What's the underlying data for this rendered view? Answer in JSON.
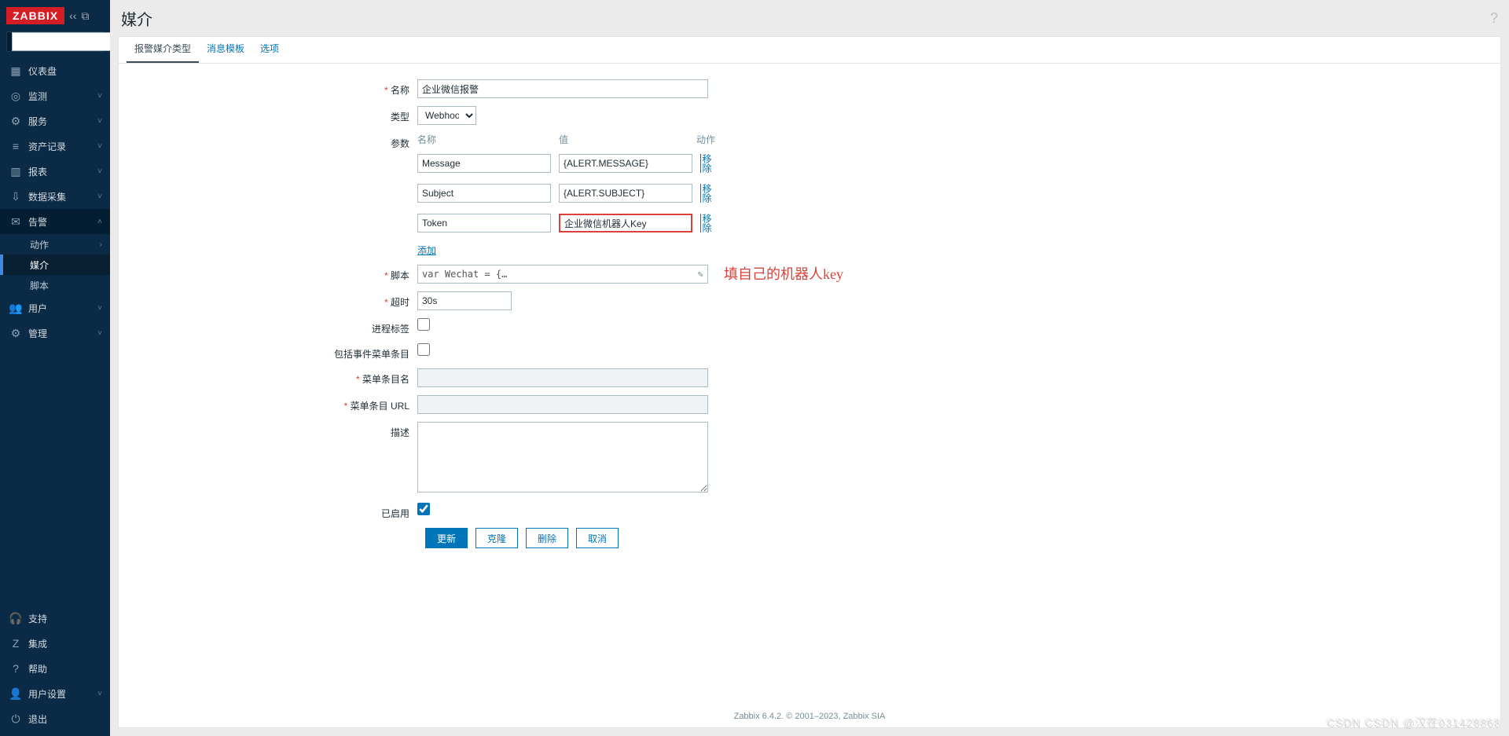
{
  "brand": "ZABBIX",
  "page_title": "媒介",
  "sidebar": {
    "items": [
      {
        "icon": "▦",
        "label": "仪表盘",
        "chev": ""
      },
      {
        "icon": "◎",
        "label": "监测",
        "chev": "˅"
      },
      {
        "icon": "⚙",
        "label": "服务",
        "chev": "˅"
      },
      {
        "icon": "≡",
        "label": "资产记录",
        "chev": "˅"
      },
      {
        "icon": "▥",
        "label": "报表",
        "chev": "˅"
      },
      {
        "icon": "⇩",
        "label": "数据采集",
        "chev": "˅"
      },
      {
        "icon": "✉",
        "label": "告警",
        "chev": "˄",
        "open": true
      },
      {
        "label": "动作",
        "chev": "›",
        "sub": true
      },
      {
        "label": "媒介",
        "sub": true,
        "active": true
      },
      {
        "label": "脚本",
        "sub": true
      },
      {
        "icon": "👥",
        "label": "用户",
        "chev": "˅"
      },
      {
        "icon": "⚙",
        "label": "管理",
        "chev": "˅"
      }
    ],
    "bottom": [
      {
        "icon": "🎧",
        "label": "支持"
      },
      {
        "icon": "Z",
        "label": "集成"
      },
      {
        "icon": "?",
        "label": "帮助"
      },
      {
        "icon": "👤",
        "label": "用户设置",
        "chev": "˅"
      },
      {
        "icon": "⏻",
        "label": "退出"
      }
    ]
  },
  "tabs": [
    {
      "label": "报警媒介类型",
      "active": true
    },
    {
      "label": "消息模板"
    },
    {
      "label": "选项"
    }
  ],
  "form": {
    "name_label": "名称",
    "name_value": "企业微信报警",
    "type_label": "类型",
    "type_value": "Webhook",
    "params_label": "参数",
    "param_head_name": "名称",
    "param_head_value": "值",
    "param_head_action": "动作",
    "params": [
      {
        "name": "Message",
        "value": "{ALERT.MESSAGE}",
        "rm": "移除"
      },
      {
        "name": "Subject",
        "value": "{ALERT.SUBJECT}",
        "rm": "移除"
      },
      {
        "name": "Token",
        "value": "企业微信机器人Key",
        "rm": "移除",
        "highlight": true
      }
    ],
    "add_link": "添加",
    "script_label": "脚本",
    "script_value": "var Wechat = {…",
    "timeout_label": "超时",
    "timeout_value": "30s",
    "proctag_label": "进程标签",
    "include_menu_label": "包括事件菜单条目",
    "menu_name_label": "菜单条目名",
    "menu_url_label": "菜单条目 URL",
    "desc_label": "描述",
    "enabled_label": "已启用"
  },
  "buttons": {
    "update": "更新",
    "clone": "克隆",
    "delete": "删除",
    "cancel": "取消"
  },
  "annotation": "填自己的机器人key",
  "footer": "Zabbix 6.4.2. © 2001–2023, Zabbix SIA",
  "watermark": "CSDN CSDN @汉在031428868"
}
